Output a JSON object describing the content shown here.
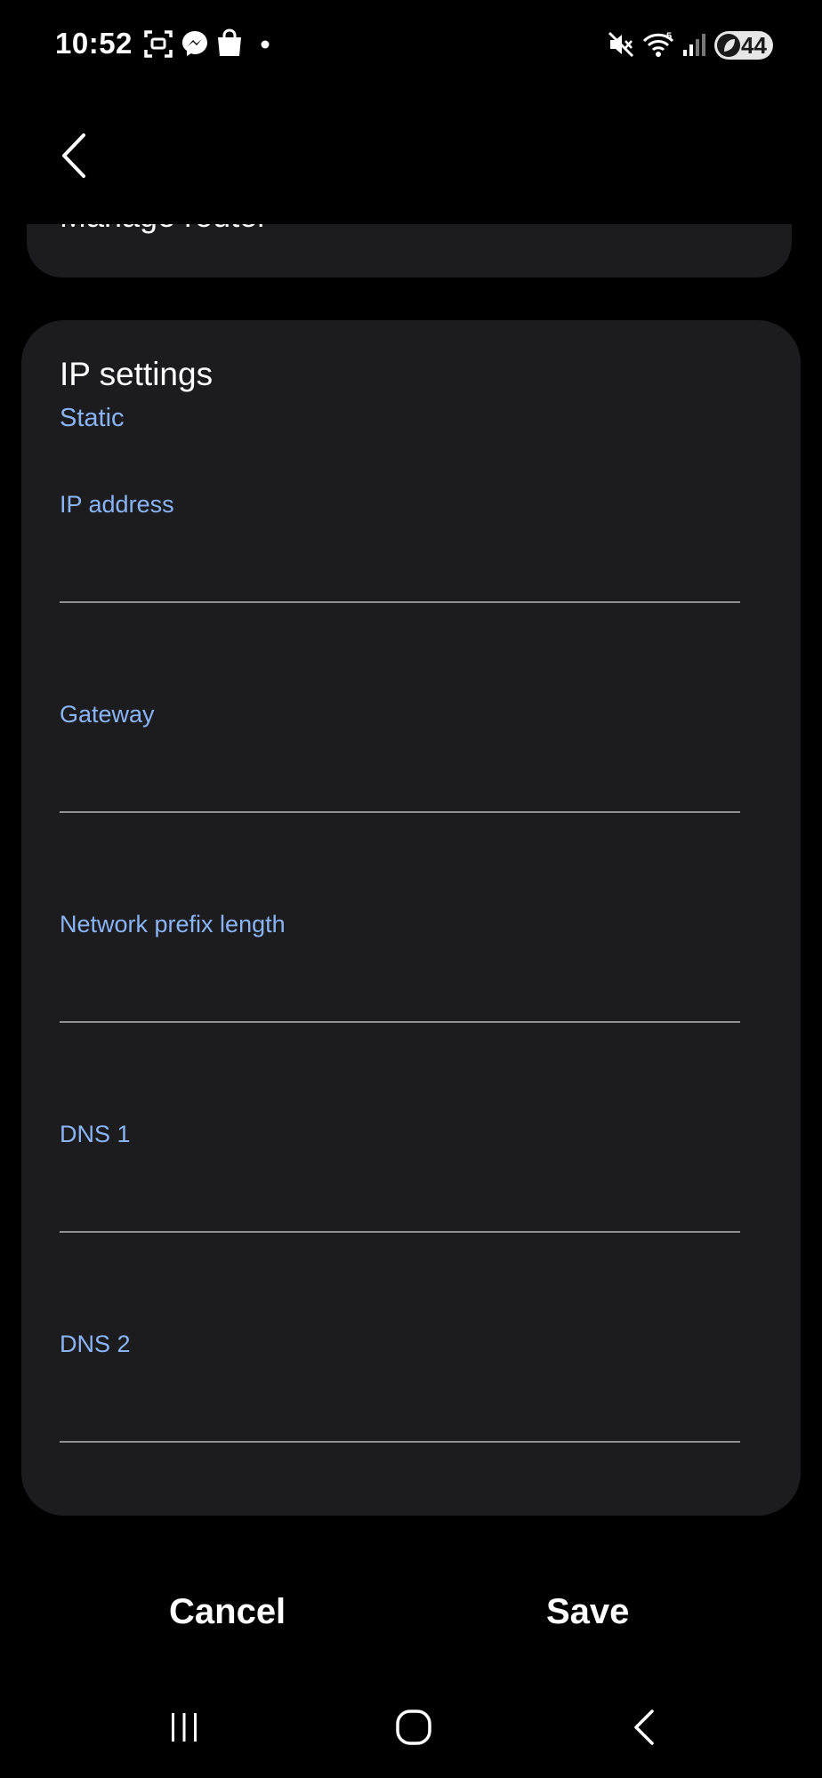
{
  "status_bar": {
    "time": "10:52",
    "battery_level": "44",
    "icons": [
      "screenshot-icon",
      "messenger-icon",
      "shopping-bag-icon",
      "dot-icon",
      "mute-icon",
      "wifi-icon",
      "signal-icon",
      "battery-icon"
    ],
    "icon_color": "#ffffff"
  },
  "header": {
    "back_icon": "chevron-left-icon"
  },
  "router": {
    "label": "Manage router"
  },
  "ip_settings": {
    "title": "IP settings",
    "mode": "Static",
    "fields": [
      {
        "label": "IP address",
        "value": "",
        "placeholder": ""
      },
      {
        "label": "Gateway",
        "value": "",
        "placeholder": ""
      },
      {
        "label": "Network prefix length",
        "value": "",
        "placeholder": ""
      },
      {
        "label": "DNS 1",
        "value": "",
        "placeholder": ""
      },
      {
        "label": "DNS 2",
        "value": "",
        "placeholder": ""
      }
    ]
  },
  "actions": {
    "cancel_label": "Cancel",
    "save_label": "Save"
  },
  "nav_bar": {
    "recents_icon": "recents-icon",
    "home_icon": "home-icon",
    "back_icon": "back-icon"
  },
  "colors": {
    "background": "#000000",
    "card": "#1c1c1e",
    "accent": "#8ab4f8",
    "divider": "#8e8e93",
    "text": "#ffffff"
  }
}
